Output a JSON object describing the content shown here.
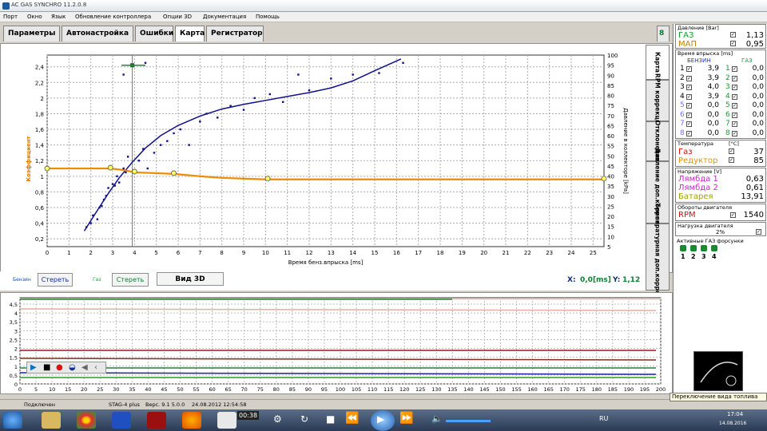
{
  "window": {
    "title": "AC GAS SYNCHRO  11.2.0.8"
  },
  "menu": [
    "Порт",
    "Окно",
    "Язык",
    "Обновление контроллера",
    "Опции 3D",
    "Документация",
    "Помощь"
  ],
  "tabs": [
    "Параметры",
    "Автонастройка",
    "Ошибки",
    "Карта",
    "Регистратор"
  ],
  "pin_label": "8",
  "side_tabs": [
    "Карта",
    "RPM коррекция",
    "Отклонение",
    "Давление доп.коррекция",
    "Температурная доп.коррекция"
  ],
  "chart_data": {
    "type": "scatter",
    "xlabel": "Время бенз.впрыска [ms]",
    "ylabel": "Коэффициент",
    "y2label": "Давление в коллекторе [kPa]",
    "xlim": [
      0,
      25.5
    ],
    "ylim": [
      0.1,
      2.55
    ],
    "y2lim": [
      5,
      100
    ],
    "x_ticks": [
      0,
      1,
      2,
      3,
      4,
      5,
      6,
      7,
      8,
      9,
      10,
      11,
      12,
      13,
      14,
      15,
      16,
      17,
      18,
      19,
      20,
      21,
      22,
      23,
      24,
      25
    ],
    "y_ticks": [
      0.2,
      0.4,
      0.6,
      0.8,
      1,
      1.2,
      1.4,
      1.6,
      1.8,
      2,
      2.2,
      2.4
    ],
    "y2_ticks": [
      5,
      10,
      15,
      20,
      25,
      30,
      35,
      40,
      45,
      50,
      55,
      60,
      65,
      70,
      75,
      80,
      85,
      90,
      95,
      100
    ],
    "series": [
      {
        "name": "Бензин",
        "color": "#10108a",
        "type": "line",
        "x": [
          1.7,
          2.2,
          2.8,
          3.3,
          3.9,
          4.5,
          5.2,
          6,
          7,
          8,
          9,
          10,
          11,
          12,
          13,
          14,
          15,
          16.2
        ],
        "y": [
          0.3,
          0.52,
          0.78,
          0.98,
          1.18,
          1.36,
          1.52,
          1.65,
          1.77,
          1.86,
          1.92,
          1.97,
          2.02,
          2.07,
          2.13,
          2.22,
          2.35,
          2.5
        ]
      },
      {
        "name": "Коэффициент",
        "color": "#f08a00",
        "type": "line",
        "x": [
          0,
          2,
          2.9,
          3.5,
          4,
          5,
          5.8,
          7,
          8,
          10,
          12,
          14,
          16,
          18,
          20,
          22,
          24,
          25.5
        ],
        "y": [
          1.1,
          1.1,
          1.1,
          1.08,
          1.05,
          1.04,
          1.03,
          1.0,
          0.98,
          0.96,
          0.96,
          0.96,
          0.96,
          0.96,
          0.96,
          0.96,
          0.96,
          0.96
        ]
      },
      {
        "name": "Точки",
        "color": "#10108a",
        "type": "scatter",
        "x": [
          1.8,
          2.0,
          2.1,
          2.3,
          2.4,
          2.5,
          2.6,
          2.7,
          2.8,
          3.0,
          3.1,
          3.2,
          3.3,
          3.5,
          3.6,
          3.7,
          4.2,
          4.4,
          4.6,
          4.9,
          5.2,
          5.5,
          5.8,
          6.1,
          6.5,
          7.0,
          7.3,
          7.8,
          8.4,
          9.0,
          9.5,
          10.2,
          10.8,
          11.5,
          12.0,
          13.0,
          14.0,
          15.2,
          16.3,
          3.5,
          4.5
        ],
        "y": [
          0.35,
          0.4,
          0.5,
          0.45,
          0.6,
          0.62,
          0.7,
          0.75,
          0.85,
          0.9,
          0.88,
          1.0,
          0.92,
          1.1,
          1.05,
          1.25,
          1.2,
          1.35,
          1.1,
          1.3,
          1.4,
          1.45,
          1.55,
          1.6,
          1.4,
          1.7,
          1.8,
          1.75,
          1.9,
          1.85,
          2.0,
          2.05,
          1.95,
          2.3,
          2.1,
          2.25,
          2.3,
          2.32,
          2.45,
          2.3,
          2.45
        ]
      },
      {
        "name": "Узлы",
        "color": "#ffff60",
        "type": "marker",
        "x": [
          2.9,
          4.0,
          5.8,
          10.1,
          25.5,
          0
        ],
        "y": [
          1.11,
          1.06,
          1.04,
          0.97,
          0.97,
          1.1
        ]
      }
    ]
  },
  "controls": {
    "benzin_label": "Бензин",
    "clear1": "Стереть",
    "gaz_label": "Газ",
    "clear2": "Стереть",
    "view3d": "Вид 3D",
    "x_label": "X:",
    "x_val": "0,0[ms]",
    "y_label": "Y:",
    "y_val": "1,12"
  },
  "panel": {
    "pressure": {
      "head": "Давление [Bar]",
      "gas_label": "ГАЗ",
      "gas_val": "1,13",
      "map_label": "МАП",
      "map_val": "0,95"
    },
    "inj_time": {
      "head": "Время впрыска [ms]",
      "col1": "БЕНЗИН",
      "col2": "ГАЗ",
      "rows": [
        {
          "n": "1",
          "b": "3,9",
          "g": "0,0"
        },
        {
          "n": "2",
          "b": "3,9",
          "g": "0,0"
        },
        {
          "n": "3",
          "b": "4,0",
          "g": "0,0"
        },
        {
          "n": "4",
          "b": "3,9",
          "g": "0,0"
        },
        {
          "n": "5",
          "b": "0,0",
          "g": "0,0"
        },
        {
          "n": "6",
          "b": "0,0",
          "g": "0,0"
        },
        {
          "n": "7",
          "b": "0,0",
          "g": "0,0"
        },
        {
          "n": "8",
          "b": "0,0",
          "g": "0,0"
        }
      ]
    },
    "temp": {
      "head": "Температура",
      "unit": "[°C]",
      "gas_label": "Газ",
      "gas_val": "37",
      "red_label": "Редуктор",
      "red_val": "85"
    },
    "voltage": {
      "head": "Напряжение [V]",
      "l1_label": "Лямбда 1",
      "l1_val": "0,63",
      "l2_label": "Лямбда 2",
      "l2_val": "0,61",
      "bat_label": "Батарея",
      "bat_val": "13,91"
    },
    "rpm": {
      "head": "Обороты двигателя",
      "label": "RPM",
      "val": "1540"
    },
    "load": {
      "head": "Нагрузка двигателя",
      "val": "2%"
    },
    "injectors": {
      "head": "Активные ГАЗ форсунки",
      "nums": [
        "1",
        "2",
        "3",
        "4"
      ]
    }
  },
  "bottom_chart": {
    "y_ticks": [
      "4,5",
      "4",
      "3,5",
      "3",
      "2,5",
      "2",
      "1,5",
      "1",
      "0,5",
      "0"
    ],
    "x_ticks": [
      "0",
      "5",
      "10",
      "15",
      "20",
      "25",
      "30",
      "35",
      "40",
      "45",
      "50",
      "55",
      "60",
      "65",
      "70",
      "75",
      "80",
      "85",
      "90",
      "95",
      "100",
      "105",
      "110",
      "115",
      "120",
      "125",
      "130",
      "135",
      "140",
      "145",
      "150",
      "155",
      "160",
      "165",
      "170",
      "175",
      "180",
      "185",
      "190",
      "195",
      "200"
    ]
  },
  "status": {
    "connected": "Подключен",
    "device": "STAG-4 plus",
    "version": "Верс. 9.1  5.0.0",
    "date": "24.08.2012 12:54:58"
  },
  "tooltip": "Переключение вида топлива",
  "taskbar": {
    "time": "00:38",
    "lang": "RU",
    "clock": "17:04",
    "date": "14.08.2016"
  }
}
